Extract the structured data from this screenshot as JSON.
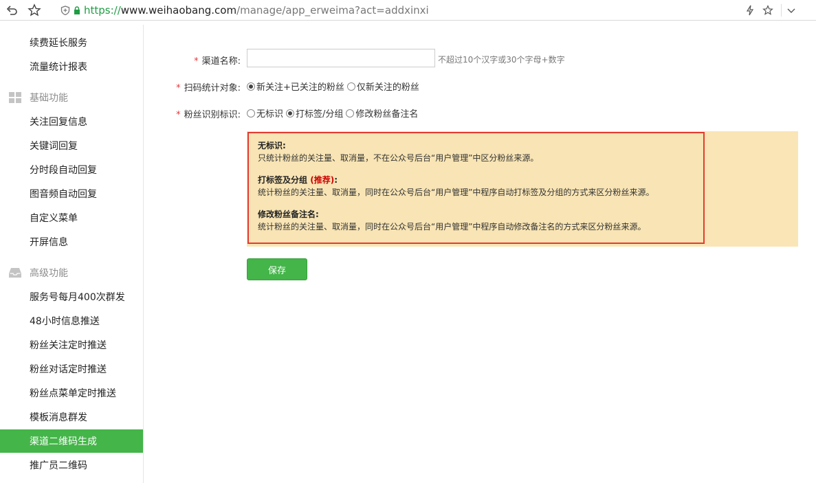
{
  "browser": {
    "url_scheme": "https://",
    "url_host": "www.weihaobang.com",
    "url_path": "/manage/app_erweima?act=addxinxi"
  },
  "sidebar": {
    "items_top": [
      {
        "label": "续费延长服务"
      },
      {
        "label": "流量统计报表"
      }
    ],
    "group_basic": {
      "label": "基础功能",
      "icon": "grid-icon"
    },
    "items_basic": [
      {
        "label": "关注回复信息"
      },
      {
        "label": "关键词回复"
      },
      {
        "label": "分时段自动回复"
      },
      {
        "label": "图音频自动回复"
      },
      {
        "label": "自定义菜单"
      },
      {
        "label": "开屏信息"
      }
    ],
    "group_advanced": {
      "label": "高级功能",
      "icon": "inbox-icon"
    },
    "items_advanced": [
      {
        "label": "服务号每月400次群发"
      },
      {
        "label": "48小时信息推送"
      },
      {
        "label": "粉丝关注定时推送"
      },
      {
        "label": "粉丝对话定时推送"
      },
      {
        "label": "粉丝点菜单定时推送"
      },
      {
        "label": "模板消息群发"
      },
      {
        "label": "渠道二维码生成",
        "active": true
      },
      {
        "label": "推广员二维码"
      }
    ],
    "active_color": "#44b549"
  },
  "form": {
    "required_mark": "*",
    "channel_name": {
      "label": "渠道名称:",
      "value": "",
      "hint": "不超过10个汉字或30个字母+数字"
    },
    "scan_target": {
      "label": "扫码统计对象:",
      "options": [
        {
          "label": "新关注+已关注的粉丝",
          "checked": true
        },
        {
          "label": "仅新关注的粉丝",
          "checked": false
        }
      ]
    },
    "fan_mark": {
      "label": "粉丝识别标识:",
      "options": [
        {
          "label": "无标识",
          "checked": false
        },
        {
          "label": "打标签/分组",
          "checked": true
        },
        {
          "label": "修改粉丝备注名",
          "checked": false
        }
      ]
    }
  },
  "info": {
    "sections": [
      {
        "title": "无标识:",
        "desc": "只统计粉丝的关注量、取消量，不在公众号后台“用户管理”中区分粉丝来源。"
      },
      {
        "title": "打标签及分组",
        "recommend": "(推荐)",
        "title_suffix": ":",
        "desc": "统计粉丝的关注量、取消量，同时在公众号后台“用户管理”中程序自动打标签及分组的方式来区分粉丝来源。"
      },
      {
        "title": "修改粉丝备注名:",
        "desc": "统计粉丝的关注量、取消量，同时在公众号后台“用户管理”中程序自动修改备注名的方式来区分粉丝来源。"
      }
    ],
    "border_color": "#e33b2e",
    "background": "#f8e4b4"
  },
  "save_button": {
    "label": "保存",
    "color": "#44b549"
  }
}
